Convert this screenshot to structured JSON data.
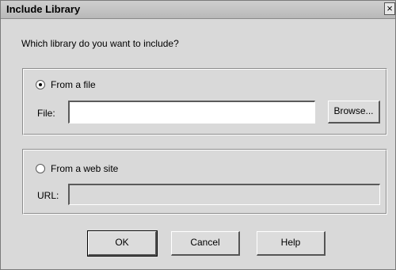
{
  "window": {
    "title": "Include Library",
    "close_label": "×"
  },
  "prompt": "Which library do you want to include?",
  "file_group": {
    "radio_label": "From a file",
    "selected": true,
    "field_label": "File:",
    "value": "",
    "browse_label": "Browse..."
  },
  "web_group": {
    "radio_label": "From a web site",
    "selected": false,
    "field_label": "URL:",
    "value": ""
  },
  "buttons": {
    "ok": "OK",
    "cancel": "Cancel",
    "help": "Help"
  }
}
